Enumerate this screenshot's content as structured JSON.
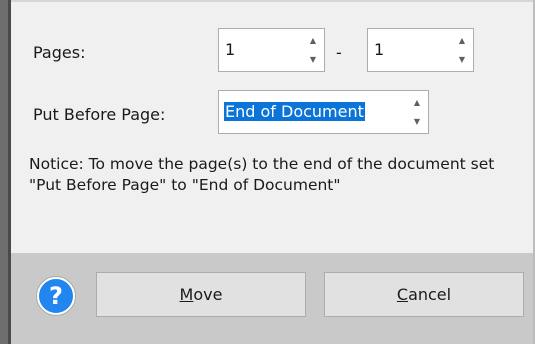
{
  "pages": {
    "label": "Pages:",
    "from_value": "1",
    "separator": "-",
    "to_value": "1"
  },
  "put_before": {
    "label": "Put Before Page:",
    "value": "End of Document"
  },
  "notice": "Notice: To move the page(s) to the end of the document set \"Put Before Page\" to \"End of Document\"",
  "help_label": "?",
  "buttons": {
    "move": {
      "mnemonic": "M",
      "rest": "ove"
    },
    "cancel": {
      "mnemonic": "C",
      "rest": "ancel"
    }
  },
  "icons": {
    "spin_up": "spin-up-arrow-icon",
    "spin_down": "spin-down-arrow-icon",
    "help": "help-icon"
  },
  "colors": {
    "selection": "#0a74d9",
    "help_blue": "#2286f0",
    "footer": "#c9c9c9",
    "background": "#f0f0f0"
  }
}
